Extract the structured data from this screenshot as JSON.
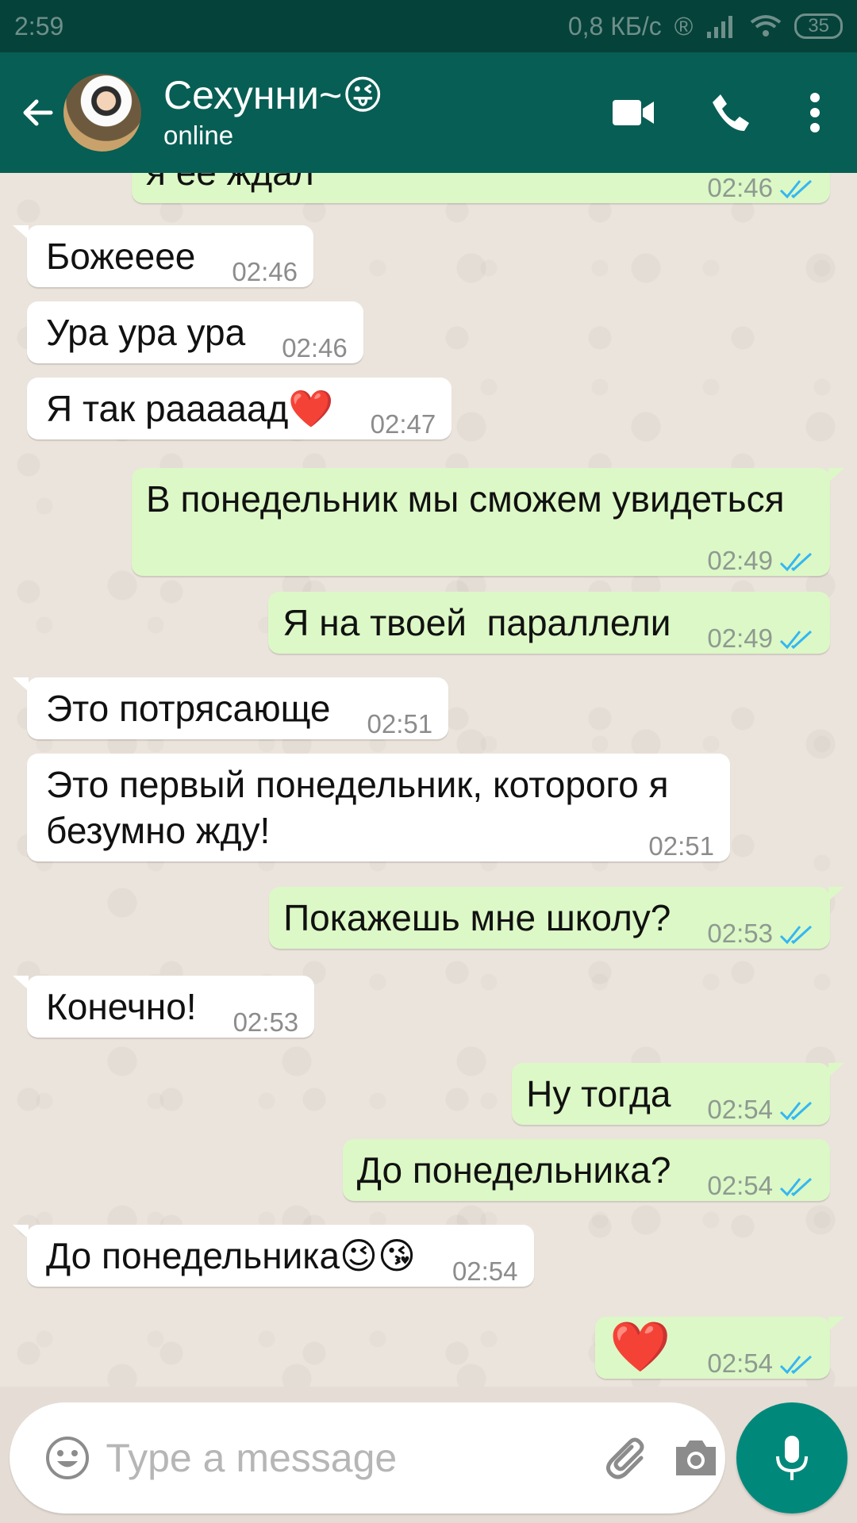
{
  "status_bar": {
    "time": "2:59",
    "net_speed": "0,8 КБ/с",
    "battery": "35"
  },
  "header": {
    "contact_name": "Сехунни~😜",
    "contact_status": "online"
  },
  "messages": [
    {
      "dir": "out",
      "text": "я ее ждал",
      "time": "02:46",
      "read": true
    },
    {
      "dir": "in",
      "text": "Божееее",
      "time": "02:46"
    },
    {
      "dir": "in",
      "text": "Ура ура ура",
      "time": "02:46"
    },
    {
      "dir": "in",
      "text": "Я так рааааад❤️",
      "time": "02:47"
    },
    {
      "dir": "out",
      "text": "В понедельник мы сможем увидеться",
      "time": "02:49",
      "read": true
    },
    {
      "dir": "out",
      "text": "Я на твоей  параллели",
      "time": "02:49",
      "read": true
    },
    {
      "dir": "in",
      "text": "Это потрясающе",
      "time": "02:51"
    },
    {
      "dir": "in",
      "text": "Это первый понедельник, которого я безумно жду!",
      "time": "02:51"
    },
    {
      "dir": "out",
      "text": "Покажешь мне школу?",
      "time": "02:53",
      "read": true
    },
    {
      "dir": "in",
      "text": "Конечно!",
      "time": "02:53"
    },
    {
      "dir": "out",
      "text": "Ну тогда",
      "time": "02:54",
      "read": true
    },
    {
      "dir": "out",
      "text": "До понедельника?",
      "time": "02:54",
      "read": true
    },
    {
      "dir": "in",
      "text": "До понедельника😉😘",
      "time": "02:54"
    },
    {
      "dir": "out",
      "text": "❤️",
      "time": "02:54",
      "read": true
    }
  ],
  "composer": {
    "placeholder": "Type a message"
  },
  "colors": {
    "header": "#075e54",
    "status_bar": "#05423a",
    "outgoing_bubble": "#dcf8c6",
    "incoming_bubble": "#ffffff",
    "read_ticks": "#34b7f1",
    "mic_button": "#00897b"
  },
  "icons": {
    "back": "arrow-left-icon",
    "video": "video-camera-icon",
    "call": "phone-icon",
    "menu": "more-vert-icon",
    "emoji": "smiley-icon",
    "attach": "paperclip-icon",
    "camera": "camera-icon",
    "mic": "microphone-icon",
    "read": "double-check-icon"
  }
}
